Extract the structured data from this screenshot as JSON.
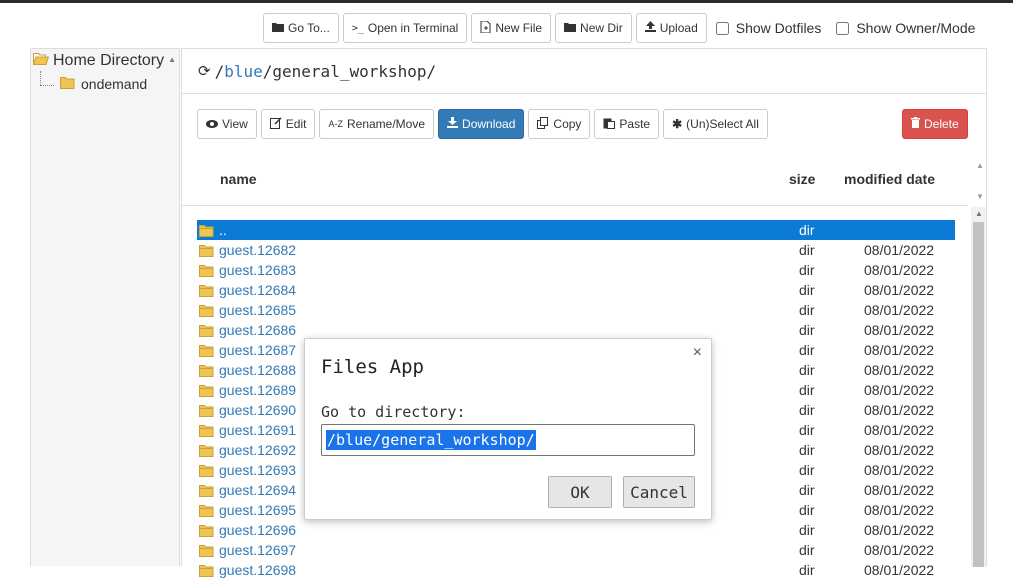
{
  "top_toolbar": {
    "goto_label": "Go To...",
    "terminal_label": "Open in Terminal",
    "new_file_label": "New File",
    "new_dir_label": "New Dir",
    "upload_label": "Upload",
    "show_dotfiles_label": "Show Dotfiles",
    "show_owner_label": "Show Owner/Mode"
  },
  "tree": {
    "root_label": "Home Directory",
    "child_label": "ondemand"
  },
  "path": {
    "prefix": "/",
    "seg1": "blue",
    "sep": "/",
    "seg2": "general_workshop",
    "suffix": "/"
  },
  "actions": {
    "view": "View",
    "edit": "Edit",
    "rename": "Rename/Move",
    "download": "Download",
    "copy": "Copy",
    "paste": "Paste",
    "select_all": "(Un)Select All",
    "delete": "Delete"
  },
  "columns": {
    "name": "name",
    "size": "size",
    "modified": "modified date"
  },
  "files": [
    {
      "name": "..",
      "size": "dir",
      "date": ""
    },
    {
      "name": "guest.12682",
      "size": "dir",
      "date": "08/01/2022"
    },
    {
      "name": "guest.12683",
      "size": "dir",
      "date": "08/01/2022"
    },
    {
      "name": "guest.12684",
      "size": "dir",
      "date": "08/01/2022"
    },
    {
      "name": "guest.12685",
      "size": "dir",
      "date": "08/01/2022"
    },
    {
      "name": "guest.12686",
      "size": "dir",
      "date": "08/01/2022"
    },
    {
      "name": "guest.12687",
      "size": "dir",
      "date": "08/01/2022"
    },
    {
      "name": "guest.12688",
      "size": "dir",
      "date": "08/01/2022"
    },
    {
      "name": "guest.12689",
      "size": "dir",
      "date": "08/01/2022"
    },
    {
      "name": "guest.12690",
      "size": "dir",
      "date": "08/01/2022"
    },
    {
      "name": "guest.12691",
      "size": "dir",
      "date": "08/01/2022"
    },
    {
      "name": "guest.12692",
      "size": "dir",
      "date": "08/01/2022"
    },
    {
      "name": "guest.12693",
      "size": "dir",
      "date": "08/01/2022"
    },
    {
      "name": "guest.12694",
      "size": "dir",
      "date": "08/01/2022"
    },
    {
      "name": "guest.12695",
      "size": "dir",
      "date": "08/01/2022"
    },
    {
      "name": "guest.12696",
      "size": "dir",
      "date": "08/01/2022"
    },
    {
      "name": "guest.12697",
      "size": "dir",
      "date": "08/01/2022"
    },
    {
      "name": "guest.12698",
      "size": "dir",
      "date": "08/01/2022"
    }
  ],
  "modal": {
    "title": "Files App",
    "close_glyph": "×",
    "label": "Go to directory:",
    "input_value": "/blue/general_workshop/",
    "ok_label": "OK",
    "cancel_label": "Cancel"
  },
  "colors": {
    "selected_row": "#0b7bd6",
    "primary": "#337ab7",
    "danger": "#d9534f",
    "folder": "#f0c44e"
  }
}
